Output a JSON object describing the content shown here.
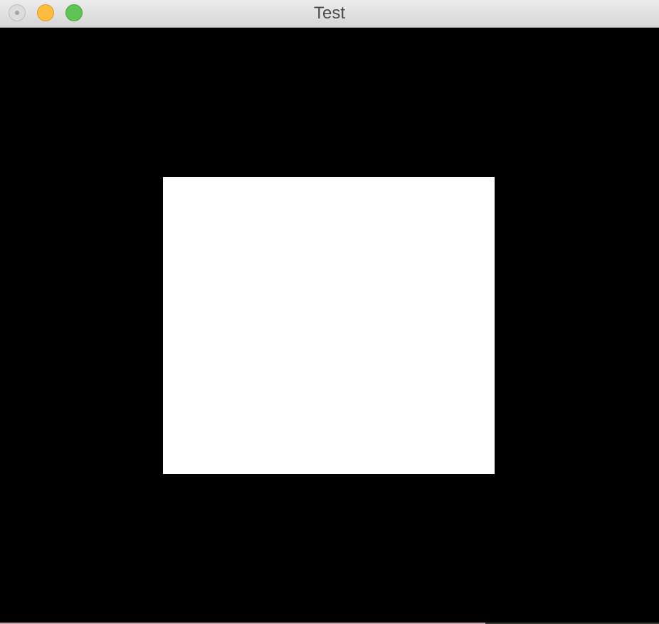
{
  "window": {
    "title": "Test"
  },
  "controls": {
    "close": "close-icon",
    "minimize": "minimize-icon",
    "zoom": "zoom-icon"
  },
  "colors": {
    "canvas_background": "#000000",
    "rectangle_fill": "#ffffff",
    "titlebar": "#e0e0e0",
    "minimize": "#fdbc40",
    "zoom": "#5fc454"
  }
}
